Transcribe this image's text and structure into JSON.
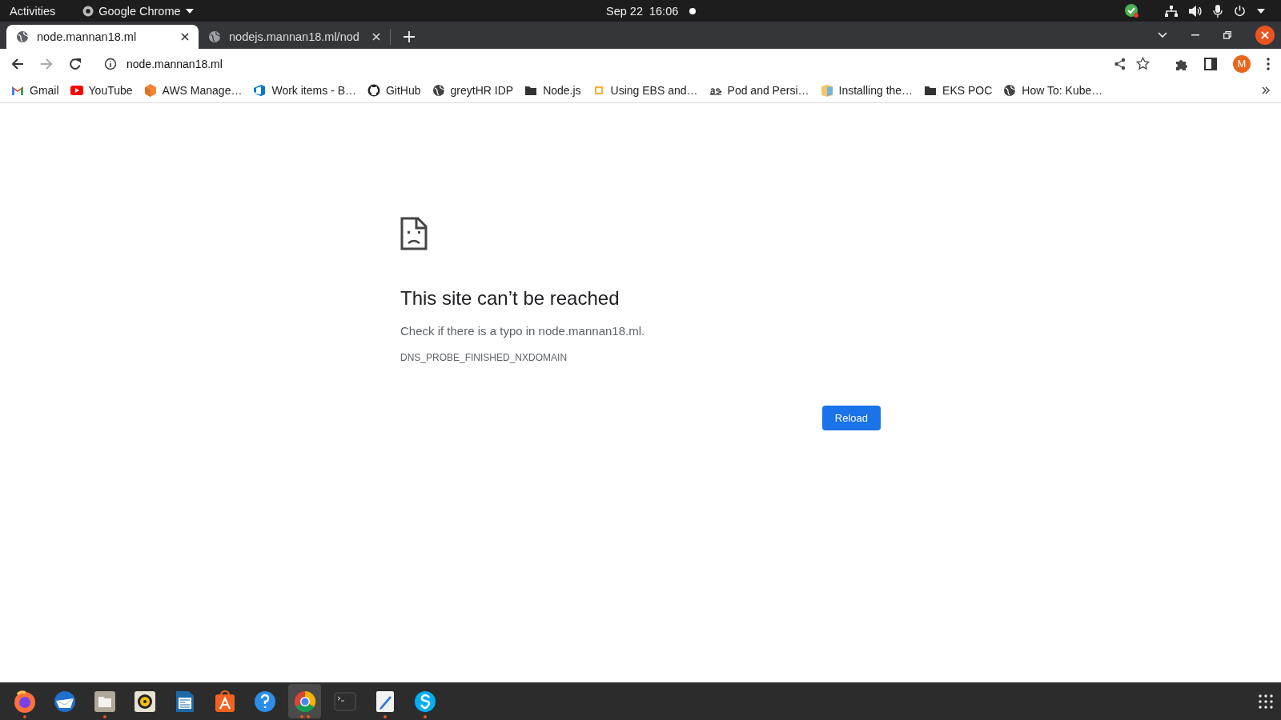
{
  "top_bar": {
    "activities": "Activities",
    "app_menu": "Google Chrome",
    "date": "Sep 22",
    "time": "16:06"
  },
  "tabs": [
    {
      "title": "node.mannan18.ml",
      "selected": true
    },
    {
      "title": "nodejs.mannan18.ml/nod",
      "selected": false
    }
  ],
  "address_bar": {
    "url": "node.mannan18.ml"
  },
  "profile": {
    "initial": "M"
  },
  "bookmarks": [
    {
      "label": "Gmail",
      "kind": "gmail"
    },
    {
      "label": "YouTube",
      "kind": "youtube"
    },
    {
      "label": "AWS Manage…",
      "kind": "cube"
    },
    {
      "label": "Work items - B…",
      "kind": "devops"
    },
    {
      "label": "GitHub",
      "kind": "github"
    },
    {
      "label": "greytHR IDP",
      "kind": "globe"
    },
    {
      "label": "Node.js",
      "kind": "folder"
    },
    {
      "label": "Using EBS and…",
      "kind": "square"
    },
    {
      "label": "Pod and Persi…",
      "kind": "as"
    },
    {
      "label": "Installing the…",
      "kind": "box"
    },
    {
      "label": "EKS POC",
      "kind": "folder"
    },
    {
      "label": "How To: Kube…",
      "kind": "globe"
    }
  ],
  "error_page": {
    "heading": "This site can’t be reached",
    "message": "Check if there is a typo in node.mannan18.ml.",
    "code": "DNS_PROBE_FINISHED_NXDOMAIN",
    "button": "Reload"
  },
  "dock": [
    {
      "kind": "firefox",
      "running": true,
      "multiple_windows": false,
      "selected": false
    },
    {
      "kind": "thunderbird",
      "running": false,
      "selected": false
    },
    {
      "kind": "files",
      "running": true,
      "multiple_windows": false,
      "selected": false
    },
    {
      "kind": "rhythmbox",
      "running": false,
      "selected": false
    },
    {
      "kind": "writer",
      "running": false,
      "selected": false
    },
    {
      "kind": "software",
      "running": false,
      "selected": false
    },
    {
      "kind": "help",
      "running": false,
      "selected": false
    },
    {
      "kind": "chrome",
      "running": true,
      "multiple_windows": true,
      "selected": true
    },
    {
      "kind": "terminal",
      "running": false,
      "selected": false
    },
    {
      "kind": "editor",
      "running": true,
      "multiple_windows": false,
      "selected": false
    },
    {
      "kind": "skype",
      "running": true,
      "multiple_windows": false,
      "selected": false
    }
  ]
}
